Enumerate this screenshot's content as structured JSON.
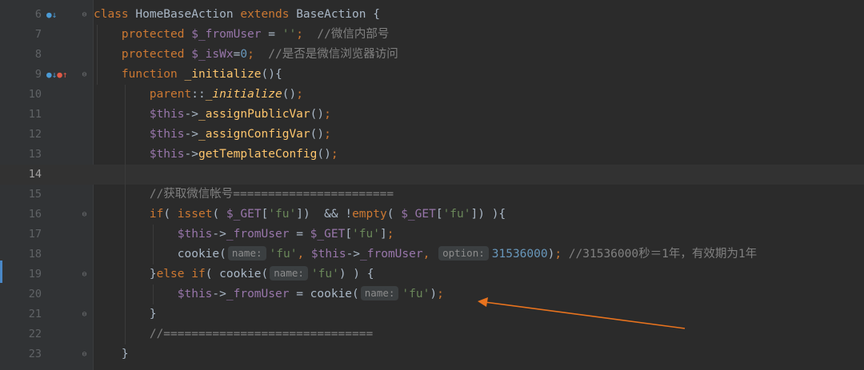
{
  "editor": {
    "current_line": 14,
    "lines": [
      {
        "n": "6",
        "segs": [
          [
            "kw",
            "class "
          ],
          [
            "pl",
            "HomeBaseAction "
          ],
          [
            "kw",
            "extends "
          ],
          [
            "pl",
            "BaseAction {"
          ]
        ]
      },
      {
        "n": "7",
        "segs": [
          [
            "kw",
            "    protected "
          ],
          [
            "var",
            "$_fromUser "
          ],
          [
            "pl",
            "= "
          ],
          [
            "str",
            "''"
          ],
          [
            "kw",
            ";"
          ],
          [
            "cm",
            "  //微信内部号"
          ]
        ]
      },
      {
        "n": "8",
        "segs": [
          [
            "kw",
            "    protected "
          ],
          [
            "var",
            "$_isWx"
          ],
          [
            "pl",
            "="
          ],
          [
            "num",
            "0"
          ],
          [
            "kw",
            ";"
          ],
          [
            "cm",
            "  //是否是微信浏览器访问"
          ]
        ]
      },
      {
        "n": "9",
        "segs": [
          [
            "kw",
            "    function "
          ],
          [
            "fn",
            "_initialize"
          ],
          [
            "pl",
            "(){"
          ]
        ]
      },
      {
        "n": "10",
        "segs": [
          [
            "kw",
            "        parent"
          ],
          [
            "pl",
            "::"
          ],
          [
            "fni",
            "_initialize"
          ],
          [
            "pl",
            "()"
          ],
          [
            "kw",
            ";"
          ]
        ]
      },
      {
        "n": "11",
        "segs": [
          [
            "var",
            "        $this"
          ],
          [
            "pl",
            "->"
          ],
          [
            "fn",
            "_assignPublicVar"
          ],
          [
            "pl",
            "()"
          ],
          [
            "kw",
            ";"
          ]
        ]
      },
      {
        "n": "12",
        "segs": [
          [
            "var",
            "        $this"
          ],
          [
            "pl",
            "->"
          ],
          [
            "fn",
            "_assignConfigVar"
          ],
          [
            "pl",
            "()"
          ],
          [
            "kw",
            ";"
          ]
        ]
      },
      {
        "n": "13",
        "segs": [
          [
            "var",
            "        $this"
          ],
          [
            "pl",
            "->"
          ],
          [
            "fn",
            "getTemplateConfig"
          ],
          [
            "pl",
            "()"
          ],
          [
            "kw",
            ";"
          ]
        ]
      },
      {
        "n": "14",
        "segs": []
      },
      {
        "n": "15",
        "segs": [
          [
            "cm",
            "        //获取微信帐号======================="
          ]
        ]
      },
      {
        "n": "16",
        "segs": [
          [
            "kw",
            "        if"
          ],
          [
            "pl",
            "( "
          ],
          [
            "kw",
            "isset"
          ],
          [
            "pl",
            "( "
          ],
          [
            "var",
            "$_GET"
          ],
          [
            "pl",
            "["
          ],
          [
            "str",
            "'fu'"
          ],
          [
            "pl",
            "])  && !"
          ],
          [
            "kw",
            "empty"
          ],
          [
            "pl",
            "( "
          ],
          [
            "var",
            "$_GET"
          ],
          [
            "pl",
            "["
          ],
          [
            "str",
            "'fu'"
          ],
          [
            "pl",
            "]) ){"
          ]
        ]
      },
      {
        "n": "17",
        "segs": [
          [
            "var",
            "            $this"
          ],
          [
            "pl",
            "->"
          ],
          [
            "var",
            "_fromUser "
          ],
          [
            "pl",
            "= "
          ],
          [
            "var",
            "$_GET"
          ],
          [
            "pl",
            "["
          ],
          [
            "str",
            "'fu'"
          ],
          [
            "pl",
            "]"
          ],
          [
            "kw",
            ";"
          ]
        ]
      },
      {
        "n": "18",
        "segs": [
          [
            "pl",
            "            cookie("
          ],
          [
            "hint",
            "name:"
          ],
          [
            "str",
            "'fu'"
          ],
          [
            "kw",
            ", "
          ],
          [
            "var",
            "$this"
          ],
          [
            "pl",
            "->"
          ],
          [
            "var",
            "_fromUser"
          ],
          [
            "kw",
            ", "
          ],
          [
            "hint",
            "option:"
          ],
          [
            "num",
            "31536000"
          ],
          [
            "pl",
            ")"
          ],
          [
            "kw",
            ";"
          ],
          [
            "cm",
            " //31536000秒＝1年，有效期为1年"
          ]
        ]
      },
      {
        "n": "19",
        "segs": [
          [
            "pl",
            "        }"
          ],
          [
            "kw",
            "else if"
          ],
          [
            "pl",
            "( cookie("
          ],
          [
            "hint",
            "name:"
          ],
          [
            "str",
            "'fu'"
          ],
          [
            "pl",
            ") ) {"
          ]
        ]
      },
      {
        "n": "20",
        "segs": [
          [
            "var",
            "            $this"
          ],
          [
            "pl",
            "->"
          ],
          [
            "var",
            "_fromUser "
          ],
          [
            "pl",
            "= cookie("
          ],
          [
            "hint",
            "name:"
          ],
          [
            "str",
            "'fu'"
          ],
          [
            "pl",
            ")"
          ],
          [
            "kw",
            ";"
          ]
        ]
      },
      {
        "n": "21",
        "segs": [
          [
            "pl",
            "        }"
          ]
        ]
      },
      {
        "n": "22",
        "segs": [
          [
            "cm",
            "        //=============================="
          ]
        ]
      },
      {
        "n": "23",
        "segs": [
          [
            "pl",
            "    }"
          ]
        ]
      }
    ]
  },
  "gutter_icons": {
    "6": [
      [
        "gi-blue",
        "●↓"
      ]
    ],
    "9": [
      [
        "gi-blue",
        "●↓"
      ],
      [
        "gi-red",
        "●↑"
      ]
    ]
  },
  "fold_markers": [
    "6",
    "9",
    "16",
    "19",
    "21",
    "23"
  ],
  "colors": {
    "background": "#2b2b2b",
    "gutter": "#313335",
    "keyword": "#cc7832",
    "string": "#6a8759",
    "number": "#6897bb",
    "comment": "#808080",
    "variable": "#9876aa",
    "function": "#ffc66d",
    "annotation_arrow": "#e8731e"
  }
}
